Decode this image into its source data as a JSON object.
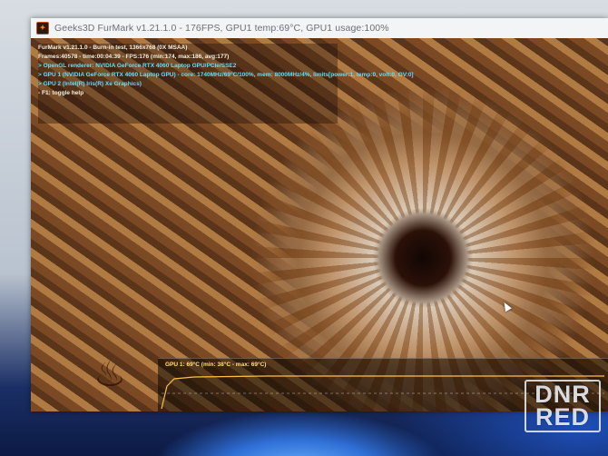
{
  "window": {
    "title": "Geeks3D FurMark v1.21.1.0 - 176FPS, GPU1 temp:69°C, GPU1 usage:100%",
    "icon": "furmark-icon"
  },
  "hud": {
    "line1": "FurMark v1.21.1.0 - Burn-in test, 1366x768 (0X MSAA)",
    "line2": "Frames:40578 - time:00:04:39 - FPS:176 (min:174, max:186, avg:177)",
    "line3": "> OpenGL renderer: NVIDIA GeForce RTX 4060 Laptop GPU/PCIe/SSE2",
    "line4": "> GPU 1 (NVIDIA GeForce RTX 4060 Laptop GPU) - core: 1740MHz/69°C/100%, mem: 8000MHz/4%, limits[power:1, temp:0, volt:0, OV:0]",
    "line5": "> GPU 2 (Intel(R) Iris(R) Xe Graphics)",
    "line6": "- F1: toggle help"
  },
  "graph": {
    "label": "GPU 1: 69°C (min: 38°C - max: 69°C)"
  },
  "watermark": {
    "line1": "DNR",
    "line2": "RED"
  },
  "colors": {
    "titlebar": "#f3f4f6",
    "hud_white": "#f4f0e0",
    "hud_cyan": "#5fe0ff",
    "graph_label": "#ffe27a"
  }
}
